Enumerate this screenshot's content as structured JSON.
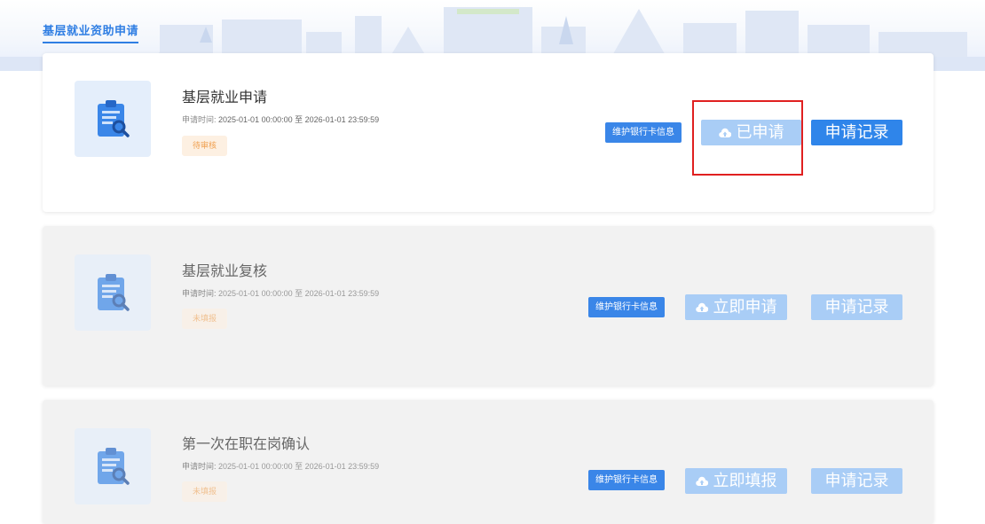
{
  "header": {
    "title": "基层就业资助申请"
  },
  "cards": [
    {
      "title": "基层就业申请",
      "time_label": "申请时间:",
      "time_range": "2025-01-01 00:00:00 至 2026-01-01 23:59:59",
      "status": "待审核",
      "bank_button": "维护银行卡信息",
      "apply_button": "已申请",
      "record_button": "申请记录"
    },
    {
      "title": "基层就业复核",
      "time_label": "申请时间:",
      "time_range": "2025-01-01 00:00:00 至 2026-01-01 23:59:59",
      "status": "未填报",
      "bank_button": "维护银行卡信息",
      "apply_button": "立即申请",
      "record_button": "申请记录"
    },
    {
      "title": "第一次在职在岗确认",
      "time_label": "申请时间:",
      "time_range": "2025-01-01 00:00:00 至 2026-01-01 23:59:59",
      "status": "未填报",
      "bank_button": "维护银行卡信息",
      "apply_button": "立即填报",
      "record_button": "申请记录"
    }
  ],
  "icons": {
    "card_icon": "clipboard-search-icon",
    "apply_icon": "cloud-upload-icon"
  },
  "colors": {
    "accent": "#2f85ea",
    "disabled": "#a9cdf6",
    "highlight": "#e02020",
    "status_text": "#f0a050"
  }
}
